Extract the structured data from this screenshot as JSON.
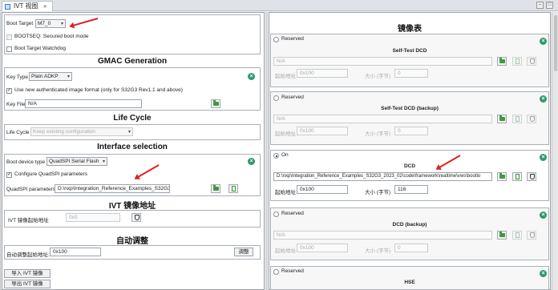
{
  "tab": {
    "title": "IVT 视图",
    "close": "✕"
  },
  "window_controls": {
    "minimize": "–",
    "maximize": "□"
  },
  "left": {
    "boot": {
      "target_label": "Boot Target",
      "target_value": "M7_0",
      "bootseq_label": "BOOTSEQ: Secured boot mode",
      "watchdog_label": "Boot Target Watchdog"
    },
    "gmac": {
      "title": "GMAC Generation",
      "key_type_label": "Key Type",
      "key_type_value": "Plain ADKP",
      "new_auth_label": "Use new authenticated image format (only for S32G3 Rev1.1 and above)",
      "key_file_label": "Key File",
      "key_file_value": "N/A"
    },
    "lifecycle": {
      "title": "Life Cycle",
      "label": "Life Cycle",
      "value": "Keep existing configuration"
    },
    "interface": {
      "title": "Interface selection",
      "boot_device_label": "Boot device type",
      "boot_device_value": "QuadSPI Serial Flash",
      "configure_label": "Configure QuadSPI parameters",
      "params_label": "QuadSPI parameters",
      "params_value": "D:\\nxp\\Integration_Reference_Examples_S32G3_2("
    },
    "ivt_addr": {
      "title": "IVT 镜像地址",
      "label": "IVT 镜像起始地址",
      "value": "0x0"
    },
    "auto": {
      "title": "自动调整",
      "label": "自动调整起始地址:",
      "value": "0x100",
      "button": "调整"
    },
    "import_button": "导入 IVT 镜像",
    "export_button": "导出 IVT 镜像"
  },
  "right": {
    "title": "镜像表",
    "sections": [
      {
        "state": "Reserved",
        "on": false,
        "name": "Self-Test DCD",
        "path": "N/A",
        "addr_label": "起始地址",
        "addr": "0x100",
        "size_label": "大小 (字节)",
        "size": "0"
      },
      {
        "state": "Reserved",
        "on": false,
        "name": "Self-Test DCD (backup)",
        "path": "N/A",
        "addr_label": "起始地址",
        "addr": "0x100",
        "size_label": "大小 (字节)",
        "size": "0"
      },
      {
        "state": "On",
        "on": true,
        "name": "DCD",
        "path": "D:\\nxp\\Integration_Reference_Examples_S32G3_2023_02\\code\\framework\\realtime\\vws\\bootlo",
        "addr_label": "起始地址",
        "addr": "0x100",
        "size_label": "大小 (字节)",
        "size": "116"
      },
      {
        "state": "Reserved",
        "on": false,
        "name": "DCD (backup)",
        "path": "N/A",
        "addr_label": "起始地址",
        "addr": "0x100",
        "size_label": "大小 (字节)",
        "size": "0"
      },
      {
        "state": "Reserved",
        "on": false,
        "name": "HSE",
        "path": "",
        "addr_label": "",
        "addr": "",
        "size_label": "",
        "size": ""
      }
    ]
  },
  "icons": {
    "folder": "folder-icon",
    "document": "document-icon",
    "shield": "shield-icon",
    "clear": "clear-x-icon"
  },
  "colors": {
    "clear_icon": "#2e9a6c",
    "folder_icon": "#3f9a3f",
    "annotation_arrow": "#e02020"
  }
}
